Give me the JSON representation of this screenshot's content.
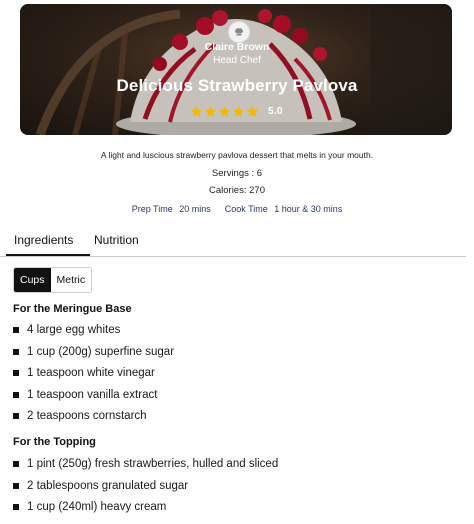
{
  "hero": {
    "chef_name": "Claire Brown",
    "chef_role": "Head Chef",
    "title": "Delicious Strawberry Pavlova",
    "rating": "5.0",
    "stars": 5,
    "star_color": "#f5b800",
    "avatar_icon": "chef-hat-icon"
  },
  "summary": {
    "description": "A light and luscious strawberry pavlova dessert that melts in your mouth.",
    "servings": "Servings : 6",
    "calories": "Calories: 270",
    "prep_label": "Prep Time",
    "prep_value": "20 mins",
    "cook_label": "Cook Time",
    "cook_value": "1 hour & 30 mins"
  },
  "tabs": [
    "Ingredients",
    "Nutrition"
  ],
  "units": [
    "Cups",
    "Metric"
  ],
  "sections": [
    {
      "title": "For the Meringue Base",
      "items": [
        "4 large egg whites",
        "1 cup (200g) superfine sugar",
        "1 teaspoon white vinegar",
        "1 teaspoon vanilla extract",
        "2 teaspoons cornstarch"
      ]
    },
    {
      "title": "For the Topping",
      "items": [
        "1 pint (250g) fresh strawberries, hulled and sliced",
        "2 tablespoons granulated sugar",
        "1 cup (240ml) heavy cream"
      ]
    }
  ]
}
